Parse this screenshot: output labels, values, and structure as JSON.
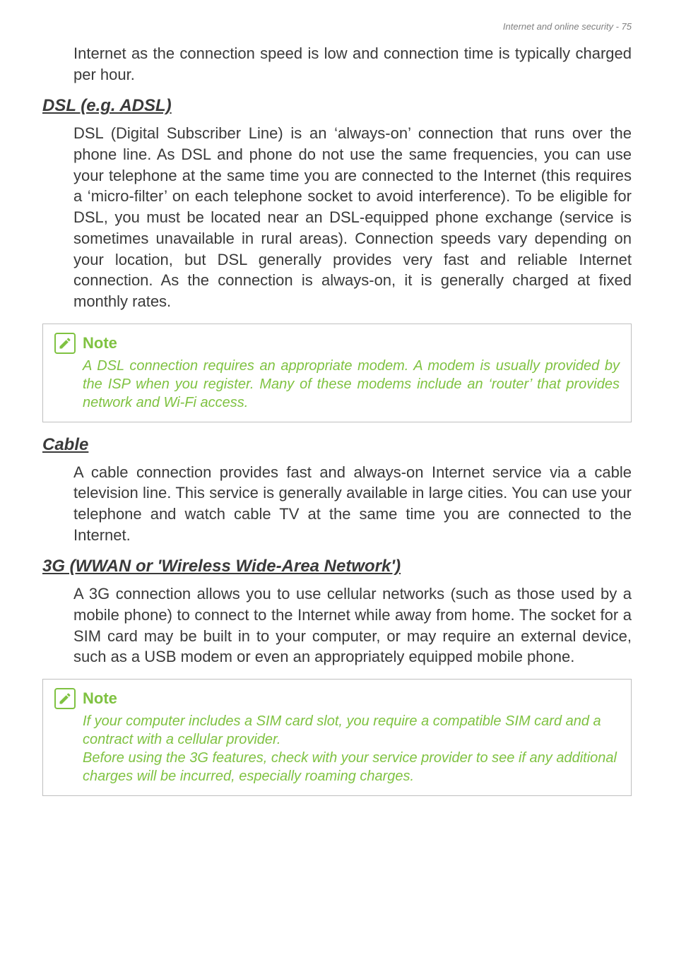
{
  "header": {
    "running_title": "Internet and online security - 75"
  },
  "intro": {
    "para": "Internet as the connection speed is low and connection time is typically charged per hour."
  },
  "dsl": {
    "heading": "DSL (e.g. ADSL)",
    "para": "DSL (Digital Subscriber Line) is an ‘always-on’ connection that runs over the phone line. As DSL and phone do not use the same frequencies, you can use your telephone at the same time you are connected to the Internet (this requires a ‘micro-filter’ on each telephone socket to avoid interference). To be eligible for DSL, you must be located near an DSL-equipped phone exchange (service is sometimes unavailable in rural areas). Connection speeds vary depending on your location, but DSL generally provides very fast and reliable Internet connection. As the connection is always-on, it is generally charged at fixed monthly rates."
  },
  "note1": {
    "title": "Note",
    "text": "A DSL connection requires an appropriate modem. A modem is usually provided by the ISP when you register. Many of these modems include an ‘router’ that provides network and Wi-Fi access."
  },
  "cable": {
    "heading": "Cable",
    "para": "A cable connection provides fast and always-on Internet service via a cable television line. This service is generally available in large cities. You can use your telephone and watch cable TV at the same time you are connected to the Internet."
  },
  "wwan": {
    "heading": "3G (WWAN or 'Wireless Wide-Area Network')",
    "para": "A 3G connection allows you to use cellular networks (such as those used by a mobile phone) to connect to the Internet while away from home. The socket for a SIM card may be built in to your computer, or may require an external device, such as a USB modem or even an appropriately equipped mobile phone."
  },
  "note2": {
    "title": "Note",
    "text1": "If your computer includes a SIM card slot, you require a compatible SIM card and a contract with a cellular provider.",
    "text2": "Before using the 3G features, check with your service provider to see if any additional charges will be incurred, especially roaming charges."
  }
}
